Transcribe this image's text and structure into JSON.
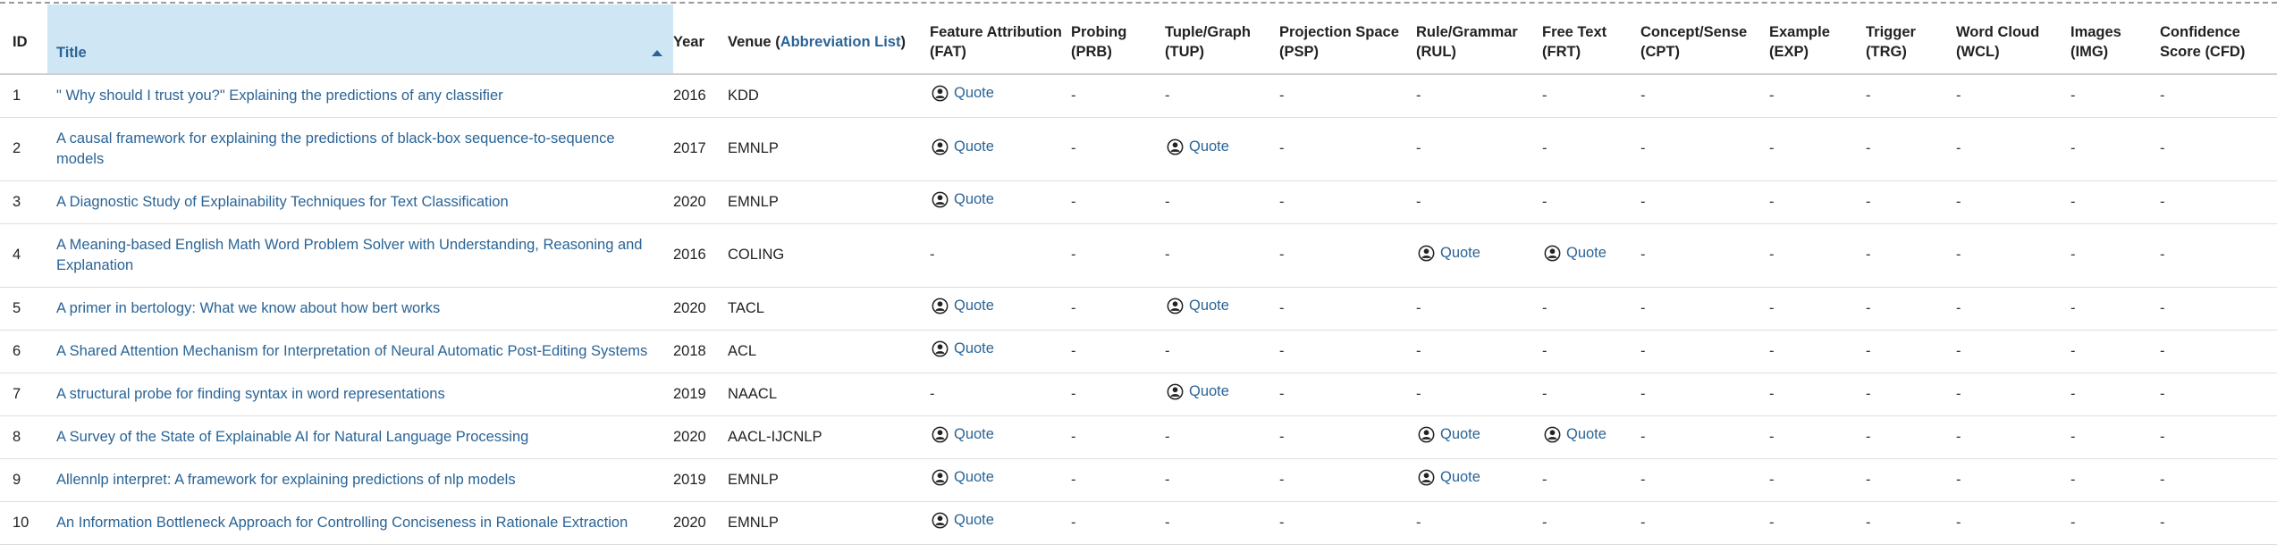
{
  "columns": [
    {
      "label": "ID"
    },
    {
      "label": "Title"
    },
    {
      "label": "Year"
    },
    {
      "label": "Venue (",
      "link": "Abbreviation List",
      "suffix": ")"
    },
    {
      "label": "Feature Attribution (FAT)"
    },
    {
      "label": "Probing (PRB)"
    },
    {
      "label": "Tuple/Graph (TUP)"
    },
    {
      "label": "Projection Space (PSP)"
    },
    {
      "label": "Rule/Grammar (RUL)"
    },
    {
      "label": "Free Text (FRT)"
    },
    {
      "label": "Concept/Sense (CPT)"
    },
    {
      "label": "Example (EXP)"
    },
    {
      "label": "Trigger (TRG)"
    },
    {
      "label": "Word Cloud (WCL)"
    },
    {
      "label": "Images (IMG)"
    },
    {
      "label": "Confidence Score (CFD)"
    }
  ],
  "quote_label": "Quote",
  "empty_mark": "-",
  "icons": {
    "quote": "quote-person-icon",
    "sort": "sort-ascending-icon"
  },
  "colors": {
    "link": "#2a6496",
    "header_active": "#cfe6f5"
  },
  "rows": [
    {
      "id": "1",
      "title": "\" Why should I trust you?\" Explaining the predictions of any classifier",
      "year": "2016",
      "venue": "KDD",
      "marks": [
        true,
        false,
        false,
        false,
        false,
        false,
        false,
        false,
        false,
        false,
        false,
        false
      ]
    },
    {
      "id": "2",
      "title": "A causal framework for explaining the predictions of black-box sequence-to-sequence models",
      "year": "2017",
      "venue": "EMNLP",
      "marks": [
        true,
        false,
        true,
        false,
        false,
        false,
        false,
        false,
        false,
        false,
        false,
        false
      ]
    },
    {
      "id": "3",
      "title": "A Diagnostic Study of Explainability Techniques for Text Classification",
      "year": "2020",
      "venue": "EMNLP",
      "marks": [
        true,
        false,
        false,
        false,
        false,
        false,
        false,
        false,
        false,
        false,
        false,
        false
      ]
    },
    {
      "id": "4",
      "title": "A Meaning-based English Math Word Problem Solver with Understanding, Reasoning and Explanation",
      "year": "2016",
      "venue": "COLING",
      "marks": [
        false,
        false,
        false,
        false,
        true,
        true,
        false,
        false,
        false,
        false,
        false,
        false
      ]
    },
    {
      "id": "5",
      "title": "A primer in bertology: What we know about how bert works",
      "year": "2020",
      "venue": "TACL",
      "marks": [
        true,
        false,
        true,
        false,
        false,
        false,
        false,
        false,
        false,
        false,
        false,
        false
      ]
    },
    {
      "id": "6",
      "title": "A Shared Attention Mechanism for Interpretation of Neural Automatic Post-Editing Systems",
      "year": "2018",
      "venue": "ACL",
      "marks": [
        true,
        false,
        false,
        false,
        false,
        false,
        false,
        false,
        false,
        false,
        false,
        false
      ]
    },
    {
      "id": "7",
      "title": "A structural probe for finding syntax in word representations",
      "year": "2019",
      "venue": "NAACL",
      "marks": [
        false,
        false,
        true,
        false,
        false,
        false,
        false,
        false,
        false,
        false,
        false,
        false
      ]
    },
    {
      "id": "8",
      "title": "A Survey of the State of Explainable AI for Natural Language Processing",
      "year": "2020",
      "venue": "AACL-IJCNLP",
      "marks": [
        true,
        false,
        false,
        false,
        true,
        true,
        false,
        false,
        false,
        false,
        false,
        false
      ]
    },
    {
      "id": "9",
      "title": "Allennlp interpret: A framework for explaining predictions of nlp models",
      "year": "2019",
      "venue": "EMNLP",
      "marks": [
        true,
        false,
        false,
        false,
        true,
        false,
        false,
        false,
        false,
        false,
        false,
        false
      ]
    },
    {
      "id": "10",
      "title": "An Information Bottleneck Approach for Controlling Conciseness in Rationale Extraction",
      "year": "2020",
      "venue": "EMNLP",
      "marks": [
        true,
        false,
        false,
        false,
        false,
        false,
        false,
        false,
        false,
        false,
        false,
        false
      ]
    }
  ]
}
